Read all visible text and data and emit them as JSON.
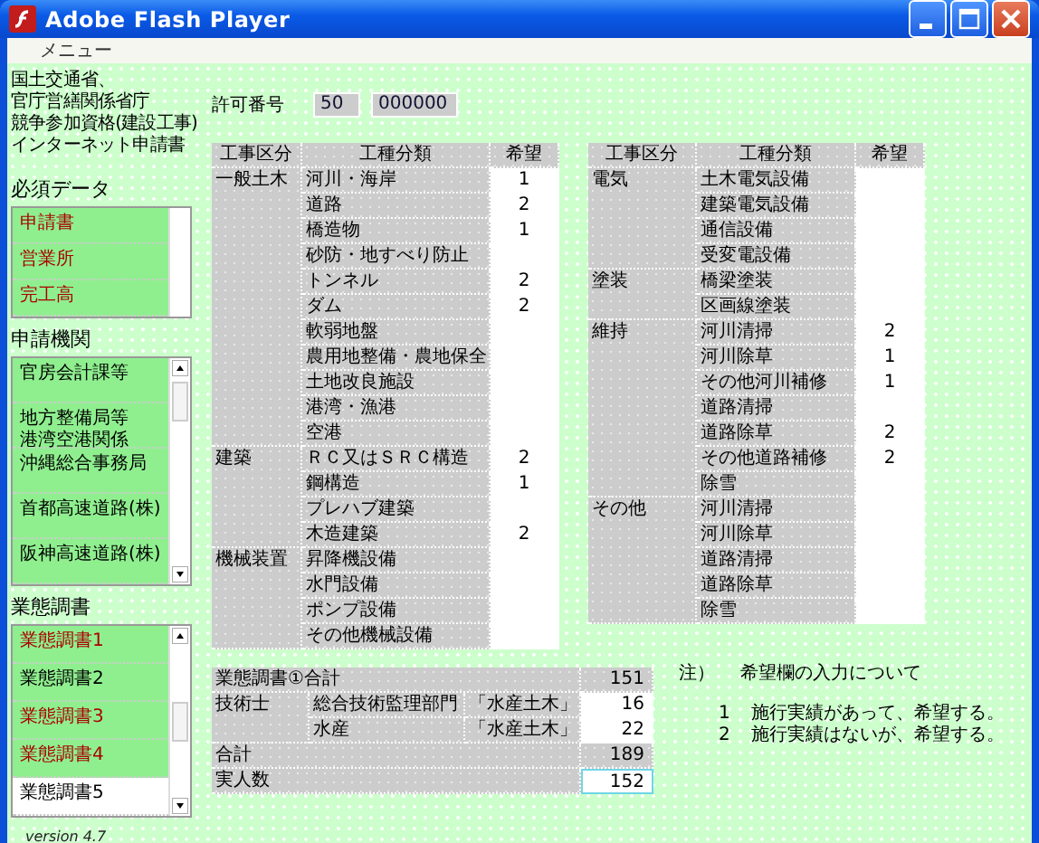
{
  "window": {
    "title": "Adobe Flash Player"
  },
  "menu": [
    "メニュー"
  ],
  "header_lines": [
    "国土交通省、",
    "官庁営繕関係省庁",
    "競争参加資格(建設工事)",
    "インターネット申請書"
  ],
  "required": {
    "title": "必須データ",
    "items": [
      {
        "label": "申請書",
        "color": "#aa0000"
      },
      {
        "label": "営業所",
        "color": "#aa0000"
      },
      {
        "label": "完工高",
        "color": "#aa0000"
      }
    ]
  },
  "agencies": {
    "title": "申請機関",
    "items": [
      {
        "lines": [
          "官房会計課等"
        ]
      },
      {
        "lines": [
          "地方整備局等",
          "港湾空港関係"
        ]
      },
      {
        "lines": [
          "沖縄総合事務局"
        ]
      },
      {
        "lines": [
          "首都高速道路(株)"
        ]
      },
      {
        "lines": [
          "阪神高速道路(株)"
        ]
      }
    ]
  },
  "surveys": {
    "title": "業態調書",
    "items": [
      {
        "label": "業態調書1",
        "color": "#aa0000",
        "selected": false
      },
      {
        "label": "業態調書2",
        "color": "#000000",
        "selected": false
      },
      {
        "label": "業態調書3",
        "color": "#aa0000",
        "selected": false
      },
      {
        "label": "業態調書4",
        "color": "#aa0000",
        "selected": false
      },
      {
        "label": "業態調書5",
        "color": "#000000",
        "selected": true
      }
    ]
  },
  "version": "version 4.7",
  "permit": {
    "label": "許可番号",
    "prefix": "50",
    "number": "000000"
  },
  "tables": [
    {
      "columns": [
        "工事区分",
        "工種分類",
        "希望"
      ],
      "groups": [
        {
          "category": "一般土木",
          "items": [
            {
              "name": "河川・海岸",
              "wish": "1"
            },
            {
              "name": "道路",
              "wish": "2"
            },
            {
              "name": "橋造物",
              "wish": "1"
            },
            {
              "name": "砂防・地すべり防止"
            },
            {
              "name": "トンネル",
              "wish": "2"
            },
            {
              "name": "ダム",
              "wish": "2"
            },
            {
              "name": "軟弱地盤"
            },
            {
              "name": "農用地整備・農地保全"
            },
            {
              "name": "土地改良施設"
            },
            {
              "name": "港湾・漁港"
            },
            {
              "name": "空港"
            }
          ]
        },
        {
          "category": "建築",
          "items": [
            {
              "name": "ＲＣ又はＳＲＣ構造",
              "wish": "2"
            },
            {
              "name": "鋼構造",
              "wish": "1"
            },
            {
              "name": "プレハブ建築"
            },
            {
              "name": "木造建築",
              "wish": "2"
            }
          ]
        },
        {
          "category": "機械装置",
          "items": [
            {
              "name": "昇降機設備"
            },
            {
              "name": "水門設備"
            },
            {
              "name": "ポンプ設備"
            },
            {
              "name": "その他機械設備"
            }
          ]
        }
      ]
    },
    {
      "columns": [
        "工事区分",
        "工種分類",
        "希望"
      ],
      "groups": [
        {
          "category": "電気",
          "items": [
            {
              "name": "土木電気設備"
            },
            {
              "name": "建築電気設備"
            },
            {
              "name": "通信設備"
            },
            {
              "name": "受変電設備"
            }
          ]
        },
        {
          "category": "塗装",
          "items": [
            {
              "name": "橋梁塗装"
            },
            {
              "name": "区画線塗装"
            }
          ]
        },
        {
          "category": "維持",
          "items": [
            {
              "name": "河川清掃",
              "wish": "2"
            },
            {
              "name": "河川除草",
              "wish": "1"
            },
            {
              "name": "その他河川補修",
              "wish": "1"
            },
            {
              "name": "道路清掃"
            },
            {
              "name": "道路除草",
              "wish": "2"
            },
            {
              "name": "その他道路補修",
              "wish": "2"
            },
            {
              "name": "除雪"
            }
          ]
        },
        {
          "category": "その他",
          "items": [
            {
              "name": "河川清掃"
            },
            {
              "name": "河川除草"
            },
            {
              "name": "道路清掃"
            },
            {
              "name": "道路除草"
            },
            {
              "name": "除雪"
            }
          ]
        }
      ]
    }
  ],
  "summary": [
    {
      "kind": "total",
      "label": "業態調書①合計",
      "value": "151"
    },
    {
      "kind": "group",
      "label": "技術士",
      "items": [
        {
          "field": "総合技術監理部門",
          "subject": "「水産土木」",
          "value": "16",
          "focused": false
        },
        {
          "field": "水産",
          "subject": "「水産土木」",
          "value": "22",
          "focused": false
        }
      ]
    },
    {
      "kind": "total",
      "label": "合計",
      "value": "189"
    },
    {
      "kind": "input",
      "label": "実人数",
      "value": "152",
      "focused": true
    }
  ],
  "note": {
    "title": "注）",
    "heading": "希望欄の入力について",
    "items": [
      {
        "number": "1",
        "text": "施行実績があって、希望する。"
      },
      {
        "number": "2",
        "text": "施行実績はないが、希望する。"
      }
    ]
  }
}
